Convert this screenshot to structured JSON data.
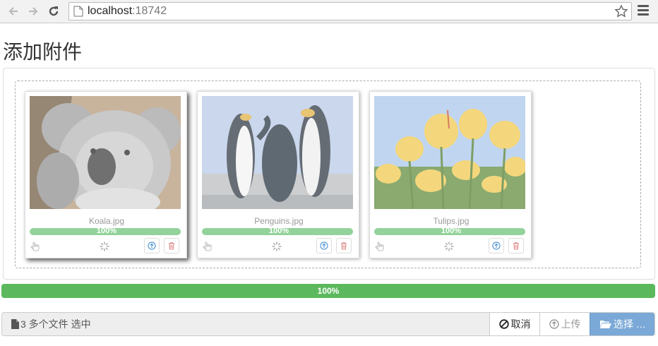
{
  "browser": {
    "url_host": "localhost",
    "url_port": ":18742"
  },
  "page": {
    "title": "添加附件"
  },
  "files": [
    {
      "name": "Koala.jpg",
      "progress_label": "100%",
      "progress": 1.0
    },
    {
      "name": "Penguins.jpg",
      "progress_label": "100%",
      "progress": 1.0
    },
    {
      "name": "Tulips.jpg",
      "progress_label": "100%",
      "progress": 1.0
    }
  ],
  "overall_progress": {
    "label": "100%",
    "value": 1.0
  },
  "file_input": {
    "caption": "3 多个文件 选中",
    "cancel_label": "取消",
    "upload_label": "上传",
    "browse_label": "选择 …"
  },
  "colors": {
    "success": "#5cb85c",
    "thumb_progress": "#93d29a",
    "browse_button": "#7ba9d7"
  }
}
